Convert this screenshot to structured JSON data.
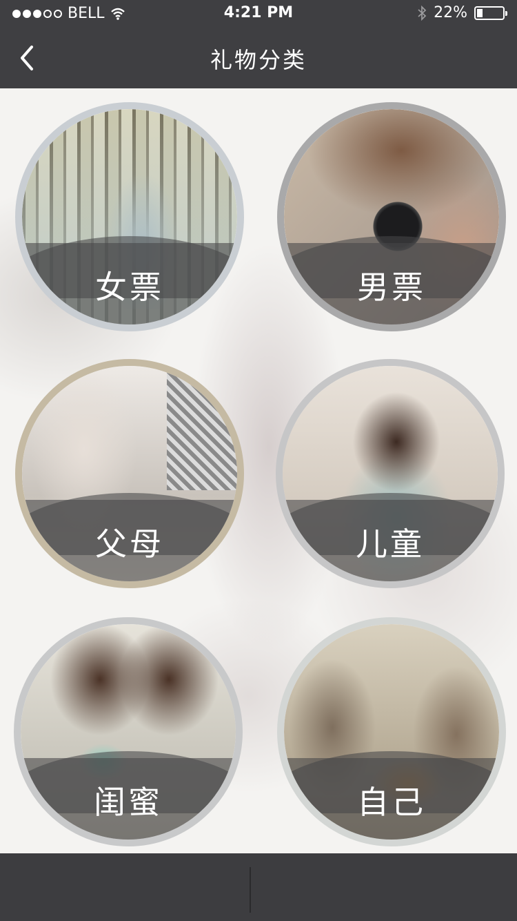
{
  "status_bar": {
    "carrier": "BELL",
    "time": "4:21 PM",
    "battery_percent": "22%",
    "battery_level": 0.22,
    "signal_icon": "signal-dots-icon",
    "wifi_icon": "wifi-icon",
    "bluetooth_icon": "bluetooth-icon"
  },
  "navbar": {
    "title": "礼物分类",
    "back_icon": "chevron-left-icon"
  },
  "categories": [
    {
      "label": "女票"
    },
    {
      "label": "男票"
    },
    {
      "label": "父母"
    },
    {
      "label": "儿童"
    },
    {
      "label": "闺蜜"
    },
    {
      "label": "自己"
    }
  ],
  "colors": {
    "bar_background": "#3f3f42",
    "label_band": "#464648",
    "text": "#ffffff"
  }
}
